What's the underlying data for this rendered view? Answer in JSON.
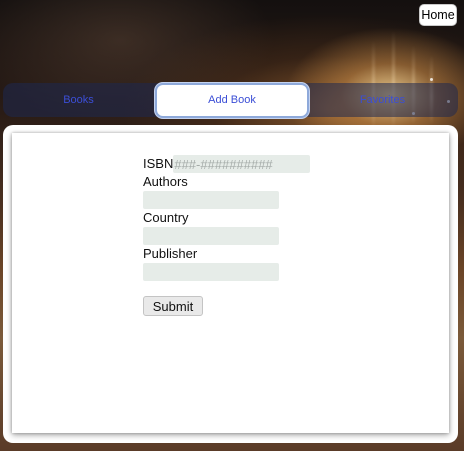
{
  "header": {
    "home_label": "Home"
  },
  "tabs": [
    {
      "label": "Books"
    },
    {
      "label": "Add Book",
      "active": true
    },
    {
      "label": "Favorites"
    }
  ],
  "form": {
    "isbn_label": "ISBN",
    "isbn_placeholder": "###-##########",
    "isbn_value": "",
    "authors_label": "Authors",
    "authors_value": "",
    "country_label": "Country",
    "country_value": "",
    "publisher_label": "Publisher",
    "publisher_value": "",
    "submit_label": "Submit"
  },
  "colors": {
    "tab_text": "#3b4ed6",
    "active_tab_border": "#8ea9da",
    "input_background": "#e6ece8"
  }
}
